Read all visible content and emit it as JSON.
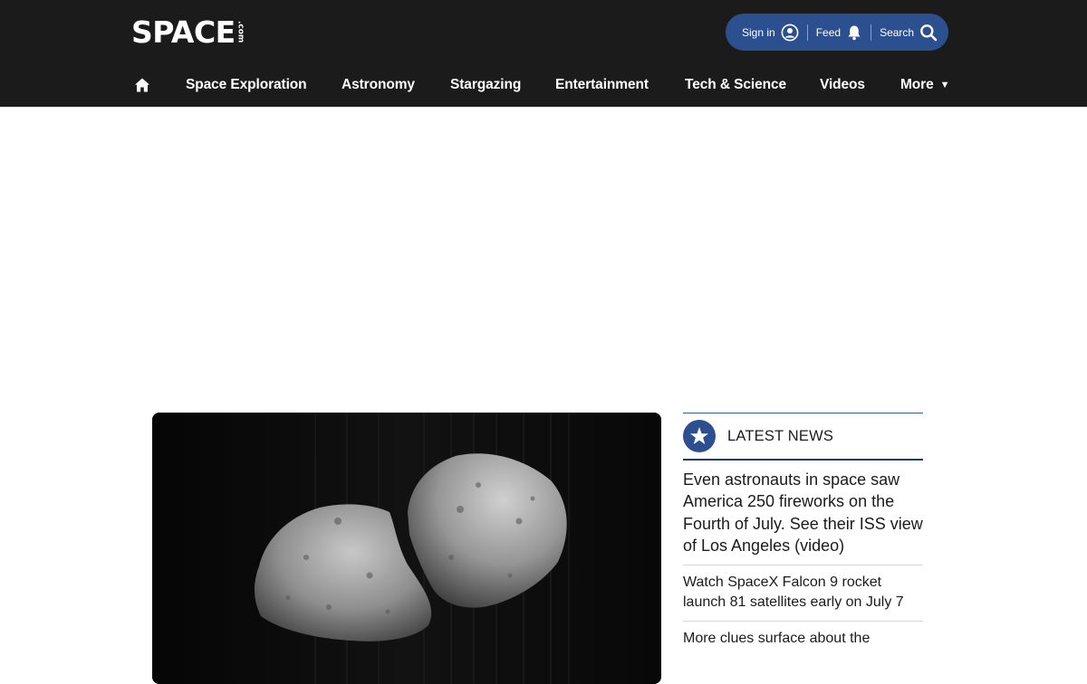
{
  "header": {
    "logo": {
      "main": "SPACE",
      "suffix": ".com"
    },
    "account": {
      "sign_in_label": "Sign in",
      "feed_label": "Feed",
      "search_label": "Search"
    }
  },
  "nav": {
    "home_icon": "home-icon",
    "items": [
      {
        "label": "Space Exploration"
      },
      {
        "label": "Astronomy"
      },
      {
        "label": "Stargazing"
      },
      {
        "label": "Entertainment"
      },
      {
        "label": "Tech & Science"
      },
      {
        "label": "Videos"
      },
      {
        "label": "More"
      }
    ]
  },
  "hero": {
    "image": "asteroid-image"
  },
  "latest_news": {
    "heading": "LATEST NEWS",
    "items": [
      {
        "title": "Even astronauts in space saw America 250 fireworks on the Fourth of July. See their ISS view of Los Angeles (video)"
      },
      {
        "title": "Watch SpaceX Falcon 9 rocket launch 81 satellites early on July 7"
      },
      {
        "title": "More clues surface about the"
      }
    ]
  },
  "colors": {
    "header_bg": "#1b1b1b",
    "accent_blue": "#2b4f8f",
    "text_dark": "#1b1b1b"
  }
}
